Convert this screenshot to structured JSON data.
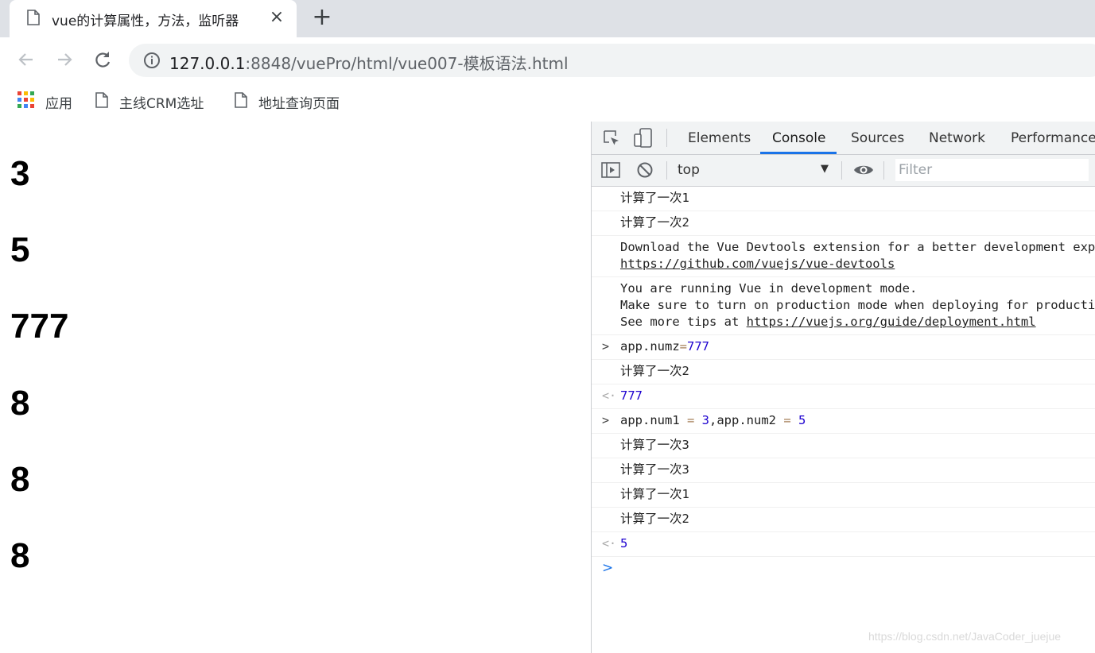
{
  "browser": {
    "tab": {
      "title": "vue的计算属性，方法，监听器",
      "close_icon": "×"
    },
    "new_tab_icon": "+",
    "url_host": "127.0.0.1",
    "url_rest": ":8848/vuePro/html/vue007-模板语法.html",
    "bookmarks": [
      {
        "label": "应用",
        "icon": "apps-grid-icon"
      },
      {
        "label": "主线CRM选址",
        "icon": "page-icon"
      },
      {
        "label": "地址查询页面",
        "icon": "page-icon"
      }
    ]
  },
  "page": {
    "headings": [
      "3",
      "5",
      "777",
      "8",
      "8",
      "8"
    ]
  },
  "devtools": {
    "tabs": [
      "Elements",
      "Console",
      "Sources",
      "Network",
      "Performance"
    ],
    "active_tab": "Console",
    "context": "top",
    "filter_placeholder": "Filter",
    "console": {
      "log1": "计算了一次1",
      "log2": "计算了一次2",
      "devtools_msg": "Download the Vue Devtools extension for a better development experience:",
      "devtools_link": "https://github.com/vuejs/vue-devtools",
      "dev_mode_1": "You are running Vue in development mode.",
      "dev_mode_2": "Make sure to turn on production mode when deploying for production.",
      "dev_mode_3_prefix": "See more tips at ",
      "dev_mode_3_link": "https://vuejs.org/guide/deployment.html",
      "input1_prop": "app.numz",
      "input1_op": "=",
      "input1_val": "777",
      "log3": "计算了一次2",
      "result1": "777",
      "input2_a": "app.num1",
      "input2_eq1": " = ",
      "input2_v1": "3",
      "input2_b": ",app.num2",
      "input2_eq2": " = ",
      "input2_v2": "5",
      "log4": "计算了一次3",
      "log5": "计算了一次3",
      "log6": "计算了一次1",
      "log7": "计算了一次2",
      "result2": "5"
    }
  },
  "watermark": "https://blog.csdn.net/JavaCoder_juejue"
}
